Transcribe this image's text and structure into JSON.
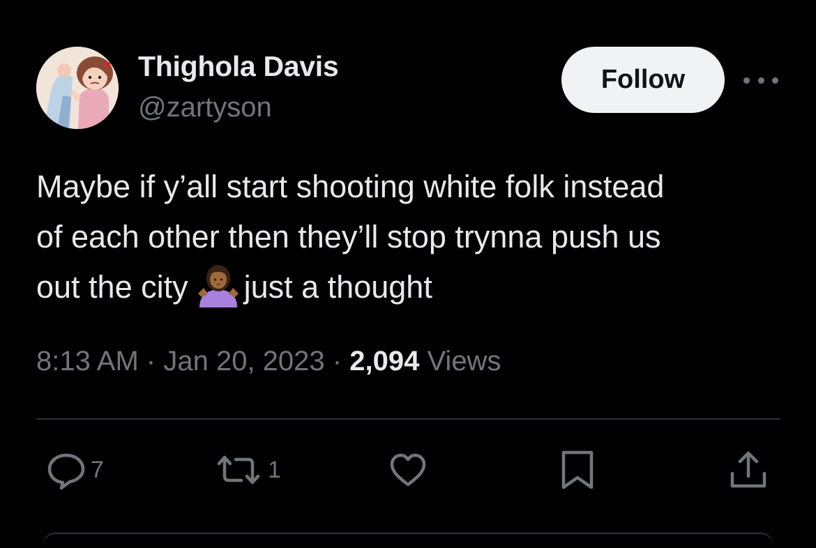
{
  "user": {
    "display_name": "Thighola Davis",
    "handle": "@zartyson",
    "avatar_icon": "cartoon-character-avatar"
  },
  "header": {
    "follow_label": "Follow",
    "more_icon": "more-horizontal-icon"
  },
  "tweet": {
    "lines": [
      "Maybe if y’all start shooting white folk instead",
      "of each other then they’ll stop trynna push us",
      "out the city"
    ],
    "line3_after_emoji": "just a thought",
    "emoji": "person-shrugging-emoji"
  },
  "meta": {
    "time": "8:13 AM",
    "separator": "·",
    "date": "Jan 20, 2023",
    "views_count": "2,094",
    "views_label": "Views"
  },
  "actions": {
    "reply_count": "7",
    "retweet_count": "1",
    "like_icon": "heart-icon",
    "bookmark_icon": "bookmark-icon",
    "share_icon": "share-icon"
  },
  "colors": {
    "background": "#000000",
    "text_primary": "#e7e9ea",
    "text_secondary": "#71767b",
    "divider": "#2f3336",
    "follow_bg": "#eff3f4"
  }
}
